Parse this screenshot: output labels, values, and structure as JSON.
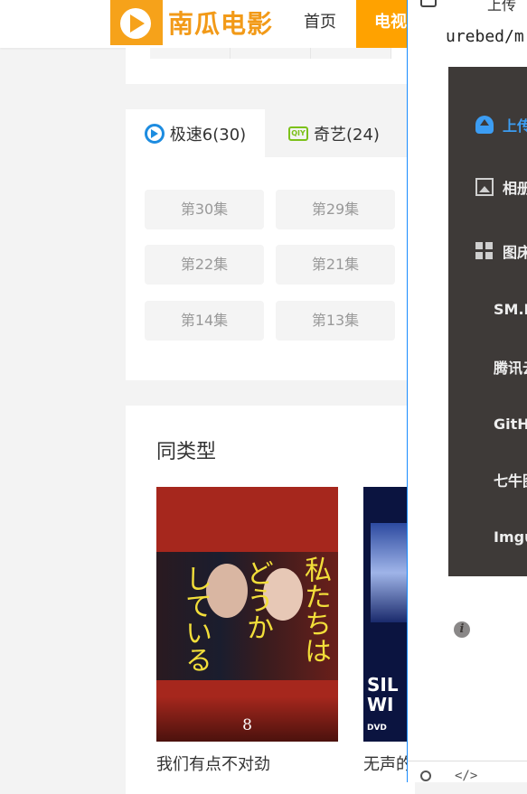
{
  "header": {
    "logo_text": "南瓜电影",
    "nav": {
      "home": "首页",
      "tv": "电视"
    }
  },
  "episodes": {
    "tabs": [
      {
        "label": "极速6(30)",
        "icon": "speed-play-icon"
      },
      {
        "label": "奇艺(24)",
        "icon": "iqiyi-icon",
        "icon_text": "QIY"
      }
    ],
    "buttons": [
      "第30集",
      "第29集",
      "第22集",
      "第21集",
      "第14集",
      "第13集"
    ]
  },
  "similar": {
    "title": "同类型",
    "items": [
      {
        "name": "我们有点不对劲",
        "rating": "8",
        "poster_text": [
          "私たちは",
          "どうか",
          "している"
        ]
      },
      {
        "name": "无声的",
        "poster_text": [
          "SIL",
          "WI"
        ],
        "badge": "DVD"
      }
    ]
  },
  "overlay": {
    "title": "上传",
    "url": "urebed/m",
    "menu": [
      {
        "label": "上传",
        "icon": "upload-cloud-icon",
        "selected": true
      },
      {
        "label": "相册",
        "icon": "image-icon"
      },
      {
        "label": "图床",
        "icon": "grid-icon"
      },
      {
        "label": "SM.MS"
      },
      {
        "label": "腾讯云"
      },
      {
        "label": "GitHub"
      },
      {
        "label": "七牛图床"
      },
      {
        "label": "Imgur"
      }
    ],
    "info_glyph": "i",
    "code_glyph": "</>"
  },
  "colors": {
    "brand_orange": "#f29a18",
    "nav_active": "#ffa200",
    "menu_bg": "#3e3a38",
    "menu_selected": "#3c9df3"
  }
}
